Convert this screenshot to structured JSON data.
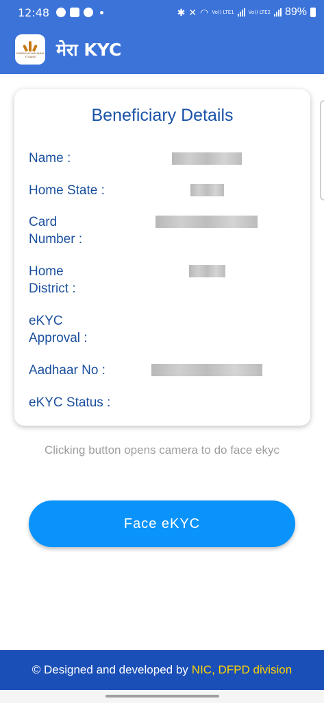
{
  "status_bar": {
    "time": "12:48",
    "volte1": "Vo)) LTE1",
    "volte2": "Vo)) LTE2",
    "battery": "89%"
  },
  "app_bar": {
    "title": "मेरा KYC",
    "logo_text": "GARIB KALYAN ANNA YOJANA"
  },
  "card": {
    "title": "Beneficiary Details",
    "fields": [
      {
        "label": "Name :"
      },
      {
        "label": "Home State :"
      },
      {
        "label": "Card\nNumber :"
      },
      {
        "label": "Home\nDistrict :"
      },
      {
        "label": "eKYC\nApproval :"
      },
      {
        "label": "Aadhaar No :"
      },
      {
        "label": "eKYC Status :"
      }
    ]
  },
  "hint": "Clicking button opens camera to do face ekyc",
  "button": {
    "label": "Face eKYC"
  },
  "footer": {
    "prefix": "© Designed and developed by",
    "highlight": "NIC, DFPD division"
  },
  "colors": {
    "app_bar": "#3b73d9",
    "button": "#0a93fb",
    "footer": "#1a4fb8",
    "label": "#1a4f9e",
    "highlight": "#ffd400"
  }
}
